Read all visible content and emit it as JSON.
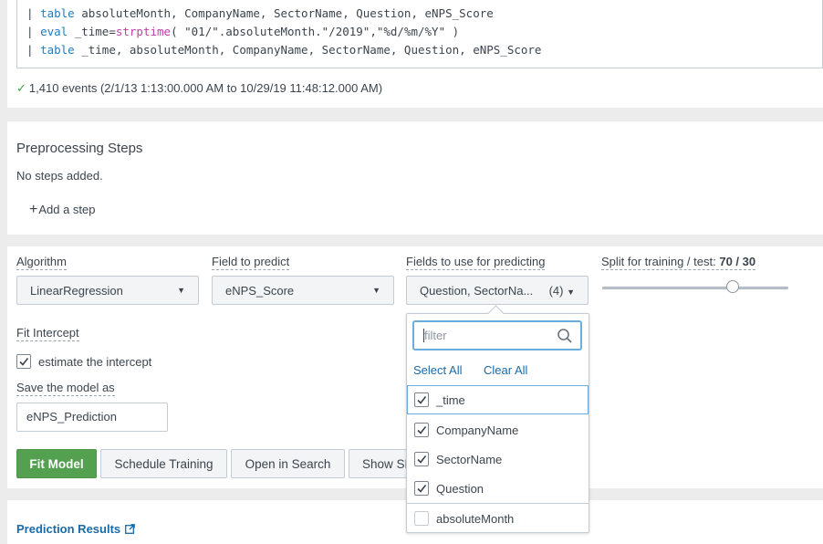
{
  "search": {
    "lines": [
      {
        "pipe": "|",
        "cmd": "table",
        "rest": " absoluteMonth, CompanyName, SectorName, Question, eNPS_Score"
      },
      {
        "pipe": "|",
        "cmd": "eval",
        "rest1": " _time=",
        "fn": "strptime",
        "rest2": "( \"01/\".absoluteMonth.\"/2019\",\"%d/%m/%Y\" )"
      },
      {
        "pipe": "|",
        "cmd": "table",
        "rest": " _time, absoluteMonth, CompanyName, SectorName, Question, eNPS_Score"
      }
    ],
    "events_text": "1,410 events (2/1/13 1:13:00.000 AM to 10/29/19 11:48:12.000 AM)",
    "check_glyph": "✓"
  },
  "preprocessing": {
    "title": "Preprocessing Steps",
    "empty_text": "No steps added.",
    "add_glyph": "+",
    "add_label": "Add a step"
  },
  "model": {
    "algorithm_label": "Algorithm",
    "algorithm_value": "LinearRegression",
    "field_label": "Field to predict",
    "field_value": "eNPS_Score",
    "fields_use_label": "Fields to use for predicting",
    "fields_use_value": "Question, SectorNa...",
    "fields_use_count": "(4)",
    "split_label": "Split for training / test:",
    "split_value": "70 / 30",
    "split_fraction": 0.7,
    "fit_intercept_label": "Fit Intercept",
    "estimate_label": "estimate the intercept",
    "estimate_checked": true,
    "save_label": "Save the model as",
    "save_value": "eNPS_Prediction",
    "caret": "▼",
    "buttons": {
      "fit": "Fit Model",
      "schedule": "Schedule Training",
      "open_search": "Open in Search",
      "show": "Show SPL"
    }
  },
  "fields_popup": {
    "filter_placeholder": "filter",
    "select_all": "Select All",
    "clear_all": "Clear All",
    "options": [
      {
        "label": "_time",
        "checked": true
      },
      {
        "label": "CompanyName",
        "checked": true
      },
      {
        "label": "SectorName",
        "checked": true
      },
      {
        "label": "Question",
        "checked": true
      },
      {
        "label": "absoluteMonth",
        "checked": false
      }
    ]
  },
  "results": {
    "title": "Prediction Results"
  },
  "colors": {
    "primary_green": "#53a051",
    "link_blue": "#1a6aa8",
    "focus_blue": "#6aaee0"
  }
}
